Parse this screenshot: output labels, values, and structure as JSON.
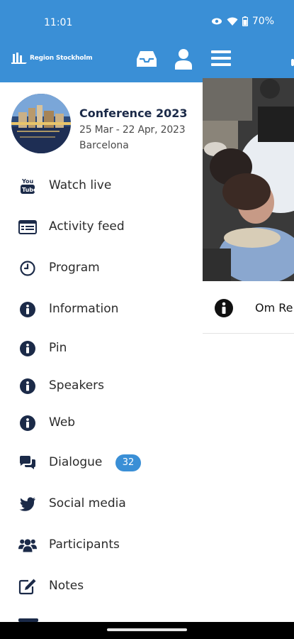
{
  "status": {
    "time": "11:01",
    "battery": "70%"
  },
  "header": {
    "brand": "Region Stockholm"
  },
  "event": {
    "title": "Conference 2023",
    "dates": "25 Mar - 22 Apr, 2023",
    "place": "Barcelona"
  },
  "menu": [
    {
      "label": "Watch live",
      "icon": "youtube-icon"
    },
    {
      "label": "Activity feed",
      "icon": "feed-icon"
    },
    {
      "label": "Program",
      "icon": "clock-icon"
    },
    {
      "label": "Information",
      "icon": "info-icon"
    },
    {
      "label": "Pin",
      "icon": "info-icon"
    },
    {
      "label": "Speakers",
      "icon": "info-icon"
    },
    {
      "label": "Web",
      "icon": "info-icon"
    },
    {
      "label": "Dialogue",
      "icon": "chat-icon",
      "badge": "32"
    },
    {
      "label": "Social media",
      "icon": "twitter-icon"
    },
    {
      "label": "Participants",
      "icon": "users-icon"
    },
    {
      "label": "Notes",
      "icon": "edit-icon"
    }
  ],
  "background_page": {
    "row_label": "Om Re"
  },
  "colors": {
    "primary": "#3a8fd6",
    "icon": "#1b2a48"
  }
}
